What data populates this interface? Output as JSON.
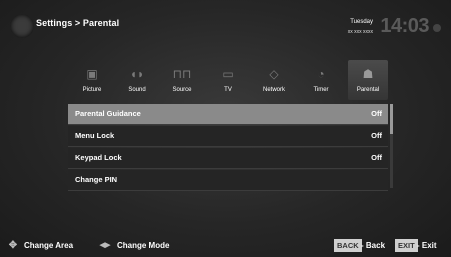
{
  "header": {
    "title": "Settings > Parental",
    "day": "Tuesday",
    "date": "xx xxx xxxx",
    "clock": "14:03"
  },
  "categories": [
    {
      "label": "Picture",
      "icon": "picture-icon"
    },
    {
      "label": "Sound",
      "icon": "sound-icon"
    },
    {
      "label": "Source",
      "icon": "source-icon"
    },
    {
      "label": "TV",
      "icon": "tv-icon"
    },
    {
      "label": "Network",
      "icon": "network-icon"
    },
    {
      "label": "Timer",
      "icon": "timer-icon"
    },
    {
      "label": "Parental",
      "icon": "parental-icon",
      "active": true
    }
  ],
  "menu": [
    {
      "label": "Parental Guidance",
      "value": "Off",
      "selected": true
    },
    {
      "label": "Menu Lock",
      "value": "Off"
    },
    {
      "label": "Keypad Lock",
      "value": "Off"
    },
    {
      "label": "Change PIN",
      "value": ""
    }
  ],
  "footer": {
    "change_area": "Change Area",
    "change_mode": "Change Mode",
    "back_key": "BACK",
    "back_label": "- Back",
    "exit_key": "EXIT",
    "exit_label": "- Exit"
  },
  "colors": {
    "selected_row": "#8a8a8a",
    "row_bg": "#252525",
    "key_bg": "#d0d0d0"
  }
}
